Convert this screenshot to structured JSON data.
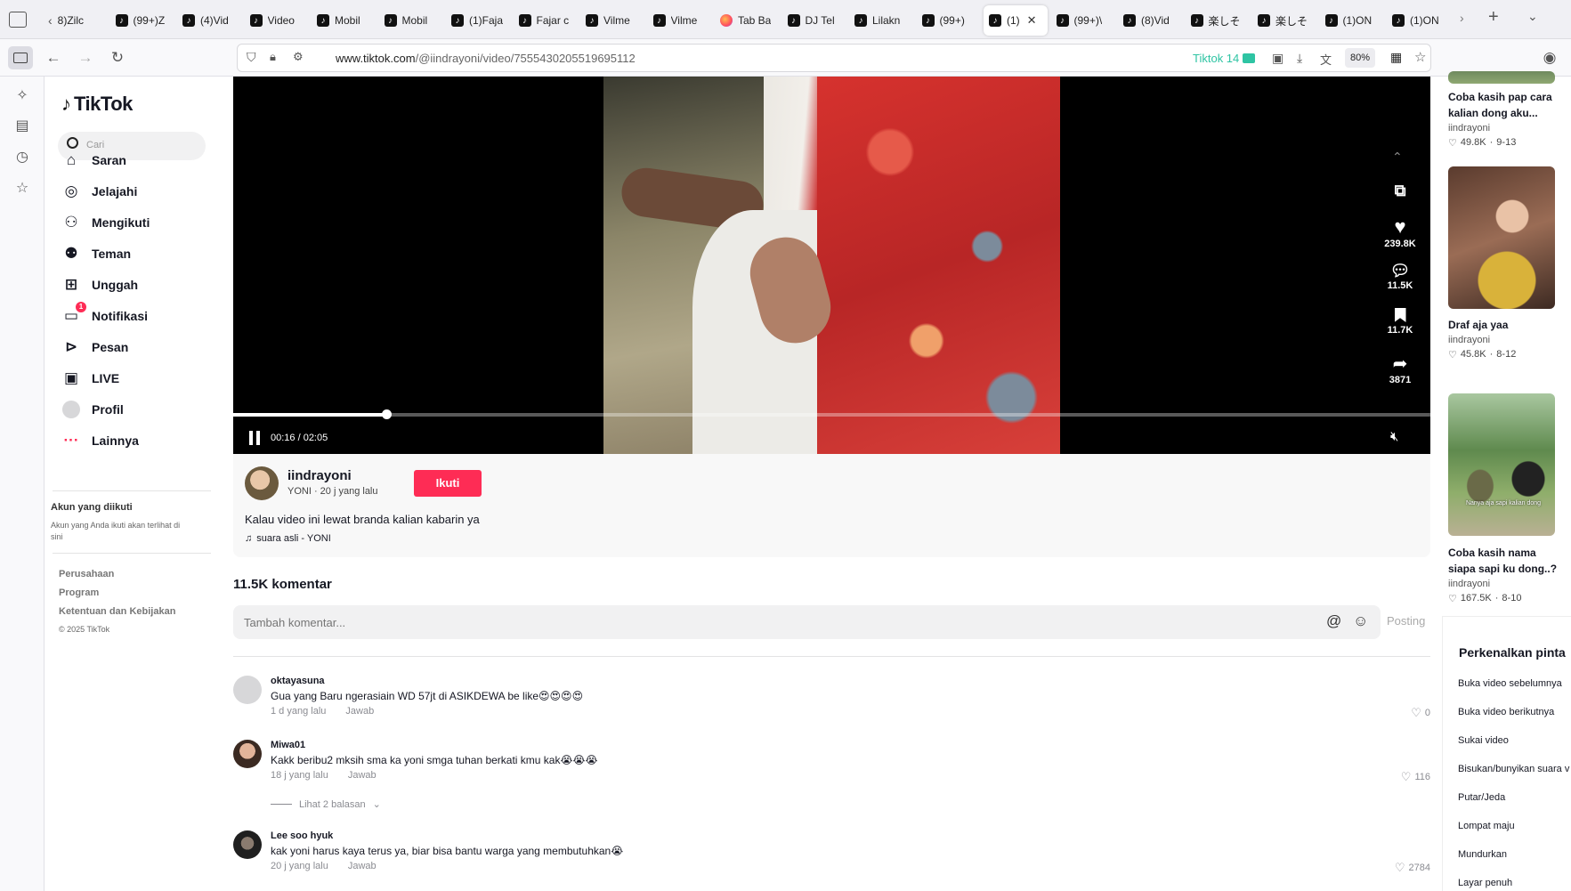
{
  "browser": {
    "tabs": [
      {
        "label": "8)Zilc",
        "icon": "back-chevron",
        "active": false
      },
      {
        "label": "(99+)Z",
        "icon": "tiktok-icon",
        "active": false
      },
      {
        "label": "(4)Vid",
        "icon": "tiktok-icon",
        "active": false
      },
      {
        "label": "Video",
        "icon": "tiktok-icon",
        "active": false
      },
      {
        "label": "Mobil",
        "icon": "tiktok-icon",
        "active": false
      },
      {
        "label": "Mobil",
        "icon": "tiktok-icon",
        "active": false
      },
      {
        "label": "(1)Faja",
        "icon": "tiktok-icon",
        "active": false
      },
      {
        "label": "Fajar c",
        "icon": "tiktok-icon",
        "active": false
      },
      {
        "label": "Vilme",
        "icon": "tiktok-icon",
        "active": false
      },
      {
        "label": "Vilme",
        "icon": "tiktok-icon",
        "active": false
      },
      {
        "label": "Tab Ba",
        "icon": "firefox-icon",
        "active": false
      },
      {
        "label": "DJ Tel",
        "icon": "tiktok-icon",
        "active": false
      },
      {
        "label": "Lilakn",
        "icon": "tiktok-icon",
        "active": false
      },
      {
        "label": "(99+)",
        "icon": "tiktok-icon",
        "active": false
      },
      {
        "label": "(1)",
        "icon": "tiktok-icon",
        "active": true
      },
      {
        "label": "(99+)\\",
        "icon": "tiktok-icon",
        "active": false
      },
      {
        "label": "(8)Vid",
        "icon": "tiktok-icon",
        "active": false
      },
      {
        "label": "楽しそ",
        "icon": "tiktok-icon",
        "active": false
      },
      {
        "label": "楽しそ",
        "icon": "tiktok-icon",
        "active": false
      },
      {
        "label": "(1)ON",
        "icon": "tiktok-icon",
        "active": false
      },
      {
        "label": "(1)ON",
        "icon": "tiktok-icon",
        "active": false
      }
    ],
    "url_host": "www.tiktok.com",
    "url_path": "/@iindrayoni/video/7555430205519695112",
    "tiktok_badge": "Tiktok 14",
    "zoom": "80%",
    "accent": "#2ec4a3"
  },
  "nav": {
    "logo": "TikTok",
    "search_placeholder": "Cari",
    "items": [
      {
        "label": "Saran",
        "icon": "home-icon"
      },
      {
        "label": "Jelajahi",
        "icon": "compass-icon"
      },
      {
        "label": "Mengikuti",
        "icon": "user-follow-icon"
      },
      {
        "label": "Teman",
        "icon": "friends-icon"
      },
      {
        "label": "Unggah",
        "icon": "upload-icon"
      },
      {
        "label": "Notifikasi",
        "icon": "notification-icon",
        "badge": "1"
      },
      {
        "label": "Pesan",
        "icon": "message-icon"
      },
      {
        "label": "LIVE",
        "icon": "live-icon"
      },
      {
        "label": "Profil",
        "icon": "avatar-icon"
      },
      {
        "label": "Lainnya",
        "icon": "more-icon"
      }
    ],
    "followed_title": "Akun yang diikuti",
    "followed_hint": "Akun yang Anda ikuti akan terlihat di sini",
    "footer": [
      "Perusahaan",
      "Program",
      "Ketentuan dan Kebijakan"
    ],
    "copyright": "© 2025 TikTok"
  },
  "video": {
    "time": "00:16 / 02:05",
    "progress": 0.128,
    "likes": "239.8K",
    "comments": "11.5K",
    "saves": "11.7K",
    "shares": "3871"
  },
  "post": {
    "username": "iindrayoni",
    "subline": "YONI · 20 j yang lalu",
    "follow_label": "Ikuti",
    "caption": "Kalau video ini lewat branda kalian kabarin ya",
    "sound": "suara asli - YONI",
    "accent": "#fe2c55"
  },
  "comments": {
    "count_label": "11.5K komentar",
    "input_placeholder": "Tambah komentar...",
    "post_label": "Posting",
    "items": [
      {
        "user": "oktayasuna",
        "text": "Gua yang Baru ngerasiain WD 57jt di ASIKDEWA be like😍😍😍😍",
        "time": "1 d yang lalu",
        "reply": "Jawab",
        "likes": "0"
      },
      {
        "user": "Miwa01",
        "text": "Kakk beribu2 mksih sma ka yoni smga tuhan berkati kmu kak😭😭😭",
        "time": "18 j yang lalu",
        "reply": "Jawab",
        "likes": "116",
        "replies_label": "Lihat 2 balasan"
      },
      {
        "user": "Lee soo hyuk",
        "text": "kak yoni harus kaya terus ya, biar bisa bantu warga yang membutuhkan😭",
        "time": "20 j yang lalu",
        "reply": "Jawab",
        "likes": "2784"
      }
    ]
  },
  "right_column": {
    "videos": [
      {
        "title": "Coba kasih pap cara kalian dong aku...",
        "author": "iindrayoni",
        "likes": "49.8K",
        "date": "9-13"
      },
      {
        "title": "Draf aja yaa",
        "author": "iindrayoni",
        "likes": "45.8K",
        "date": "8-12"
      },
      {
        "title": "Coba kasih nama siapa sapi ku dong..?",
        "author": "iindrayoni",
        "likes": "167.5K",
        "date": "8-10",
        "overlay": "Nanya aja sapi kalian dong"
      }
    ],
    "shortcuts_title": "Perkenalkan pinta",
    "shortcuts": [
      "Buka video sebelumnya",
      "Buka video berikutnya",
      "Sukai video",
      "Bisukan/bunyikan suara v",
      "Putar/Jeda",
      "Lompat maju",
      "Mundurkan",
      "Layar penuh"
    ]
  }
}
